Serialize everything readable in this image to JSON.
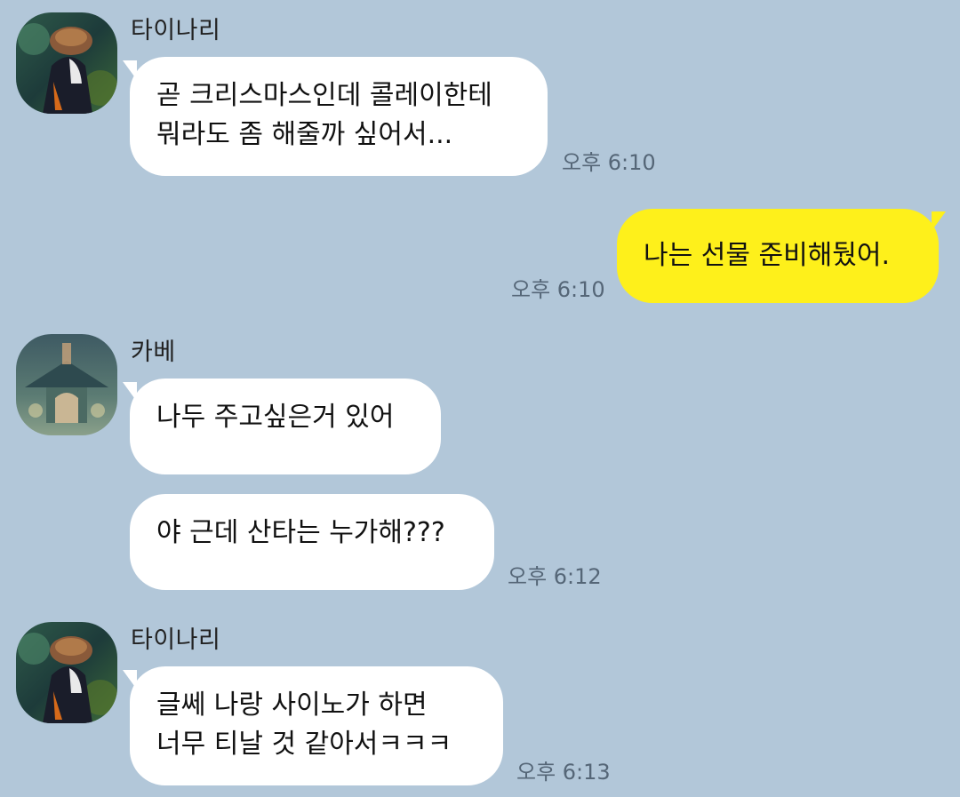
{
  "colors": {
    "background": "#b2c7d9",
    "incoming_bubble": "#ffffff",
    "outgoing_bubble": "#fef01b",
    "timestamp": "#556677"
  },
  "messages": [
    {
      "sender": "타이나리",
      "avatar_icon": "taihnari-profile-image",
      "text": "곧 크리스마스인데 콜레이한테\n뭐라도 좀 해줄까 싶어서...",
      "time": "오후 6:10"
    },
    {
      "sender": "",
      "text": "나는 선물 준비해뒀어.",
      "time": "오후 6:10"
    },
    {
      "sender": "카베",
      "avatar_icon": "kaveh-profile-image",
      "text": "나두 주고싶은거 있어",
      "time": ""
    },
    {
      "sender": "",
      "text": "야 근데 산타는 누가해???",
      "time": "오후 6:12"
    },
    {
      "sender": "타이나리",
      "avatar_icon": "taihnari-profile-image",
      "text": "글쎄 나랑 사이노가 하면\n너무 티날 것 같아서ㅋㅋㅋ",
      "time": "오후 6:13"
    }
  ]
}
